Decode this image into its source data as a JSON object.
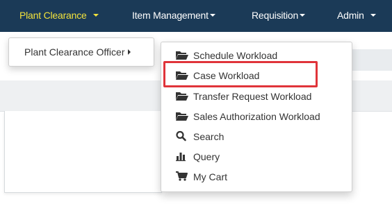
{
  "navbar": {
    "items": [
      {
        "label": "Plant Clearance"
      },
      {
        "label": "Item Management"
      },
      {
        "label": "Requisition"
      },
      {
        "label": "Admin"
      }
    ]
  },
  "dropdown": {
    "level1_item": "Plant Clearance Officer",
    "submenu": [
      {
        "label": "Schedule Workload",
        "icon": "folder-open-icon"
      },
      {
        "label": "Case Workload",
        "icon": "folder-open-icon"
      },
      {
        "label": "Transfer Request Workload",
        "icon": "folder-open-icon"
      },
      {
        "label": "Sales Authorization Workload",
        "icon": "folder-open-icon"
      },
      {
        "label": "Search",
        "icon": "search-icon"
      },
      {
        "label": "Query",
        "icon": "bar-chart-icon"
      },
      {
        "label": "My Cart",
        "icon": "cart-icon"
      }
    ]
  },
  "colors": {
    "navbar_bg": "#1b3a57",
    "active_nav": "#f2e23c",
    "highlight": "#e0343a"
  }
}
